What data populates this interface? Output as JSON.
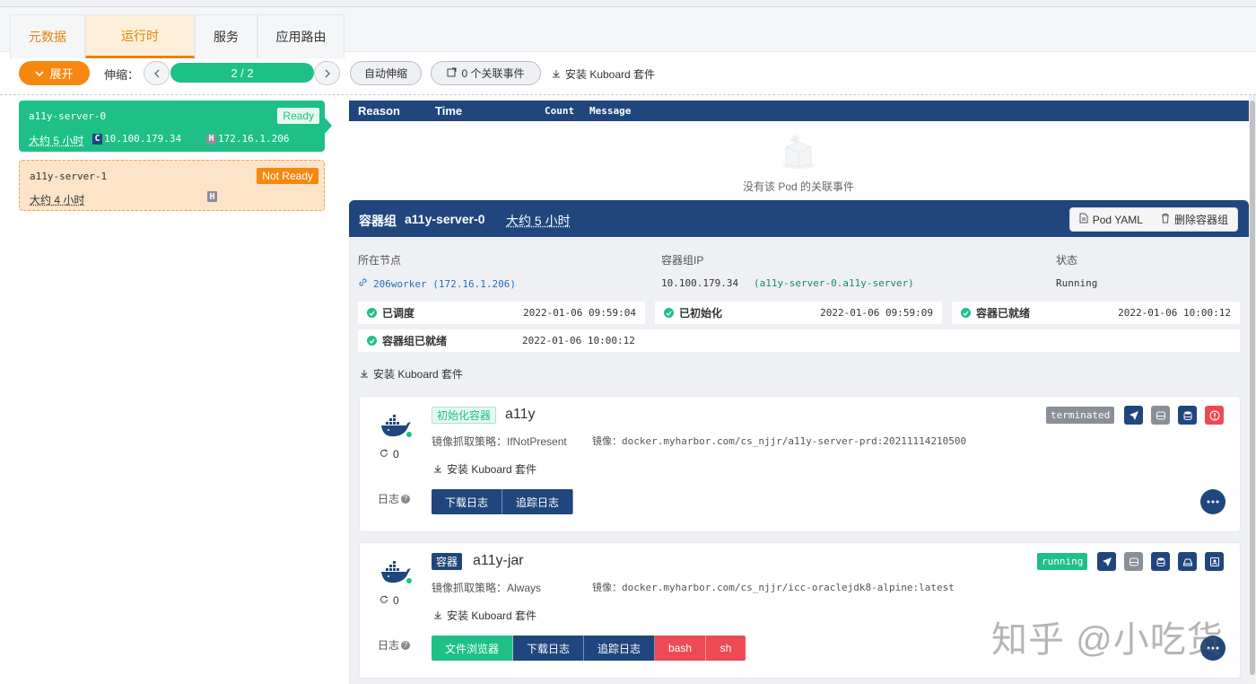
{
  "tabs": [
    {
      "label": "元数据"
    },
    {
      "label": "运行时"
    },
    {
      "label": "服务"
    },
    {
      "label": "应用路由"
    }
  ],
  "toolbar": {
    "expand_label": "展开",
    "scale_label": "伸缩：",
    "replicas": "2 / 2",
    "autoscale_label": "自动伸缩",
    "events_label": "0 个关联事件",
    "install_kuboard": "安装 Kuboard 套件"
  },
  "pods": [
    {
      "name": "a11y-server-0",
      "status": "Ready",
      "age": "大约 5 小时",
      "c_tag": "C",
      "container_ip": "10.100.179.34",
      "h_tag": "H",
      "host_ip": "172.16.1.206"
    },
    {
      "name": "a11y-server-1",
      "status": "Not Ready",
      "age": "大约 4 小时",
      "h_tag": "H"
    }
  ],
  "events": {
    "headers": {
      "reason": "Reason",
      "time": "Time",
      "count": "Count",
      "message": "Message"
    },
    "empty_text": "没有该 Pod 的关联事件"
  },
  "pod_group": {
    "label": "容器组",
    "name": "a11y-server-0",
    "age": "大约 5 小时",
    "yaml_btn": "Pod YAML",
    "delete_btn": "删除容器组",
    "node_label": "所在节点",
    "node_value": "206worker (172.16.1.206)",
    "ip_label": "容器组IP",
    "ip_value": "10.100.179.34",
    "ip_dns": "(a11y-server-0.a11y-server)",
    "status_label": "状态",
    "status_value": "Running",
    "conditions": [
      {
        "name": "已调度",
        "time": "2022-01-06 09:59:04"
      },
      {
        "name": "已初始化",
        "time": "2022-01-06 09:59:09"
      },
      {
        "name": "容器已就绪",
        "time": "2022-01-06 10:00:12"
      },
      {
        "name": "容器组已就绪",
        "time": "2022-01-06 10:00:12"
      }
    ],
    "install_kuboard": "安装 Kuboard 套件"
  },
  "containers": [
    {
      "tag": "初始化容器",
      "name": "a11y",
      "restarts": "0",
      "pull_policy": "镜像抓取策略：IfNotPresent",
      "image": "镜像：docker.myharbor.com/cs_njjr/a11y-server-prd:20211114210500",
      "install_kuboard": "安装 Kuboard 套件",
      "state": "terminated",
      "logs_label": "日志",
      "buttons": [
        "下载日志",
        "追踪日志"
      ]
    },
    {
      "tag": "容器",
      "name": "a11y-jar",
      "restarts": "0",
      "pull_policy": "镜像抓取策略：Always",
      "image": "镜像：docker.myharbor.com/cs_njjr/icc-oraclejdk8-alpine:latest",
      "install_kuboard": "安装 Kuboard 套件",
      "state": "running",
      "logs_label": "日志",
      "buttons": [
        "文件浏览器",
        "下载日志",
        "追踪日志",
        "bash",
        "sh"
      ]
    }
  ],
  "watermark": "知乎 @小吃货",
  "colors": {
    "primary": "#20467d",
    "green": "#1ec087",
    "orange": "#f7880f",
    "red": "#ee4a55",
    "gray_tag": "#8a8f98"
  }
}
